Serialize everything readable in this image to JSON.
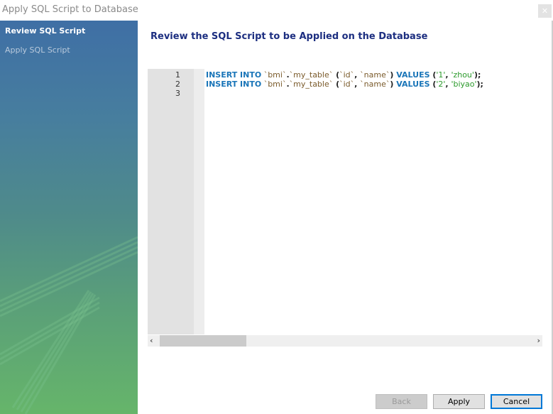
{
  "window": {
    "title": "Apply SQL Script to Database",
    "close_icon": "close-icon"
  },
  "sidebar": {
    "steps": [
      {
        "label": "Review SQL Script",
        "active": true
      },
      {
        "label": "Apply SQL Script",
        "active": false
      }
    ]
  },
  "main": {
    "heading": "Review the SQL Script to be Applied on the Database",
    "editor": {
      "line_numbers": [
        "1",
        "2",
        "3"
      ],
      "lines": [
        {
          "kw1": "INSERT INTO",
          "schema": " `bmi`",
          "dot": ".",
          "table": "`my_table`",
          "open": " (",
          "col1": "`id`",
          "comma1": ", ",
          "col2": "`name`",
          "close": ")",
          "kw2": " VALUES ",
          "vopen": "(",
          "v1": "'1'",
          "vcomma": ", ",
          "v2": "'zhou'",
          "vclose": ");"
        },
        {
          "kw1": "INSERT INTO",
          "schema": " `bmi`",
          "dot": ".",
          "table": "`my_table`",
          "open": " (",
          "col1": "`id`",
          "comma1": ", ",
          "col2": "`name`",
          "close": ")",
          "kw2": " VALUES ",
          "vopen": "(",
          "v1": "'2'",
          "vcomma": ", ",
          "v2": "'biyao'",
          "vclose": ");"
        }
      ]
    },
    "scrollbar": {
      "left_arrow": "‹",
      "right_arrow": "›"
    }
  },
  "buttons": {
    "back": "Back",
    "apply": "Apply",
    "cancel": "Cancel"
  },
  "colors": {
    "keyword": "#1a75b8",
    "string": "#2b9a2b",
    "heading": "#1c2e80",
    "focus": "#0078d7"
  }
}
